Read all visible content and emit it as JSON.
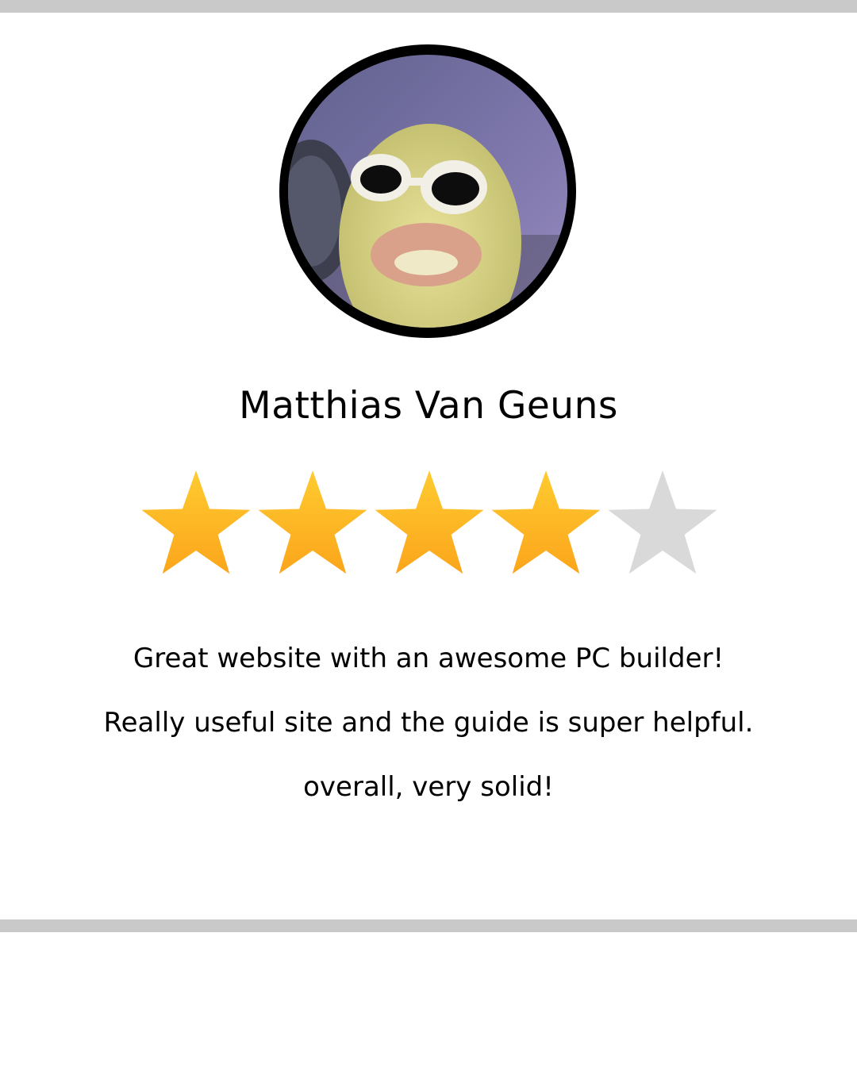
{
  "reviewer": {
    "name": "Matthias Van Geuns",
    "avatar_icon": "duckling-with-sunglasses-avatar"
  },
  "rating": {
    "value": 4,
    "max": 5,
    "filled_color": "#fbb21f",
    "empty_color": "#d9d9d9",
    "icon": "star-icon"
  },
  "review": {
    "lines": [
      "Great website with an awesome PC builder!",
      "Really useful site and the guide is super helpful.",
      "overall, very solid!"
    ]
  },
  "colors": {
    "divider": "#c9c9c9",
    "text": "#000000",
    "background": "#ffffff"
  }
}
